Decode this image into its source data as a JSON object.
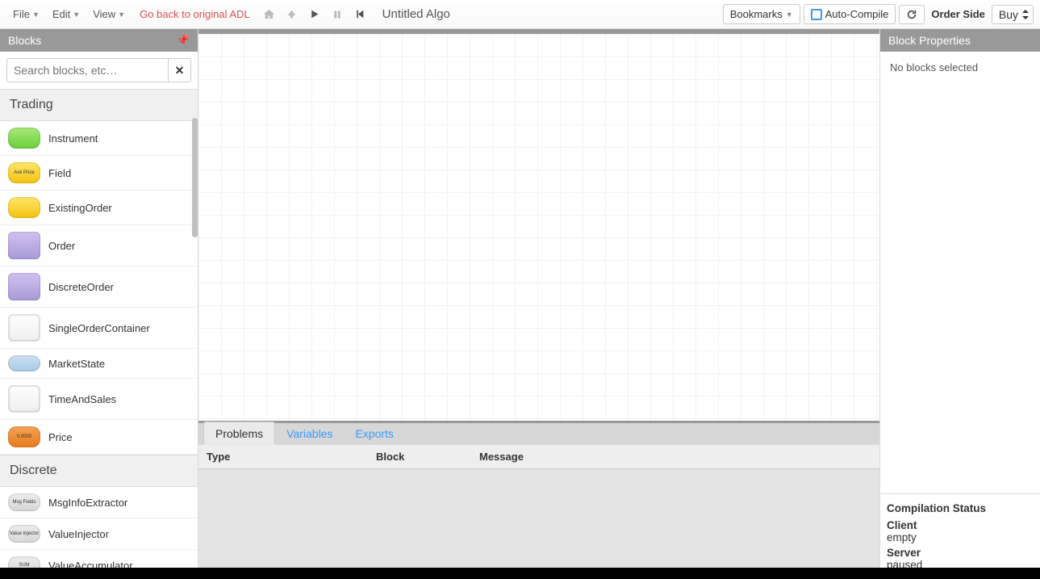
{
  "menu": {
    "file": "File",
    "edit": "Edit",
    "view": "View",
    "adl_link": "Go back to original ADL"
  },
  "title": "Untitled Algo",
  "toolbar": {
    "bookmarks": "Bookmarks",
    "auto_compile": "Auto-Compile",
    "order_side_label": "Order Side",
    "order_side_value": "Buy"
  },
  "blocks_panel": {
    "header": "Blocks",
    "search_placeholder": "Search blocks, etc…",
    "sections": [
      {
        "title": "Trading",
        "items": [
          {
            "label": "Instrument",
            "icon": "icon-green",
            "text": ""
          },
          {
            "label": "Field",
            "icon": "icon-yellow",
            "text": "Ask Price"
          },
          {
            "label": "ExistingOrder",
            "icon": "icon-yellow",
            "text": ""
          },
          {
            "label": "Order",
            "icon": "icon-purple",
            "text": ""
          },
          {
            "label": "DiscreteOrder",
            "icon": "icon-purple",
            "text": ""
          },
          {
            "label": "SingleOrderContainer",
            "icon": "icon-white",
            "text": ""
          },
          {
            "label": "MarketState",
            "icon": "icon-blue",
            "text": ""
          },
          {
            "label": "TimeAndSales",
            "icon": "icon-white",
            "text": ""
          },
          {
            "label": "Price",
            "icon": "icon-orange",
            "text": "0.0000"
          }
        ]
      },
      {
        "title": "Discrete",
        "items": [
          {
            "label": "MsgInfoExtractor",
            "icon": "icon-grey",
            "text": "Msg Fields"
          },
          {
            "label": "ValueInjector",
            "icon": "icon-grey",
            "text": "Value Injector"
          },
          {
            "label": "ValueAccumulator",
            "icon": "icon-grey",
            "text": "SUM"
          }
        ]
      }
    ]
  },
  "tabs": {
    "problems": "Problems",
    "variables": "Variables",
    "exports": "Exports"
  },
  "problems_columns": {
    "type": "Type",
    "block": "Block",
    "message": "Message"
  },
  "properties": {
    "header": "Block Properties",
    "empty": "No blocks selected"
  },
  "compile": {
    "heading": "Compilation Status",
    "client_label": "Client",
    "client_value": "empty",
    "server_label": "Server",
    "server_value": "paused"
  }
}
